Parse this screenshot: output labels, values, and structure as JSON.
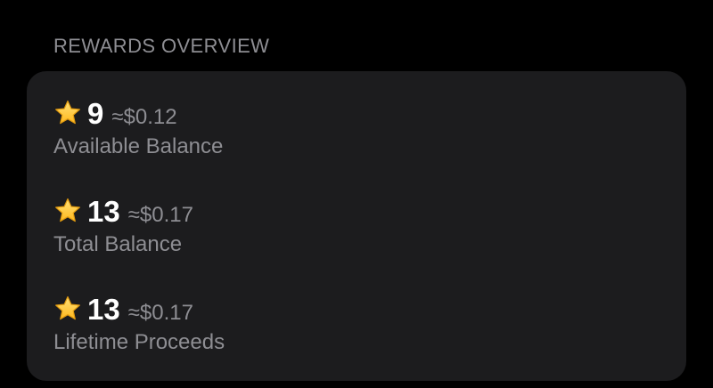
{
  "section": {
    "title": "REWARDS OVERVIEW"
  },
  "rewards": [
    {
      "icon": "star-icon",
      "amount": "9",
      "approx": "≈$0.12",
      "label": "Available Balance"
    },
    {
      "icon": "star-icon",
      "amount": "13",
      "approx": "≈$0.17",
      "label": "Total Balance"
    },
    {
      "icon": "star-icon",
      "amount": "13",
      "approx": "≈$0.17",
      "label": "Lifetime Proceeds"
    }
  ],
  "colors": {
    "background": "#000000",
    "card": "#1c1c1e",
    "primary_text": "#ffffff",
    "secondary_text": "#8e8e93",
    "star_fill": "#ffc933",
    "star_stroke": "#e09a10"
  }
}
